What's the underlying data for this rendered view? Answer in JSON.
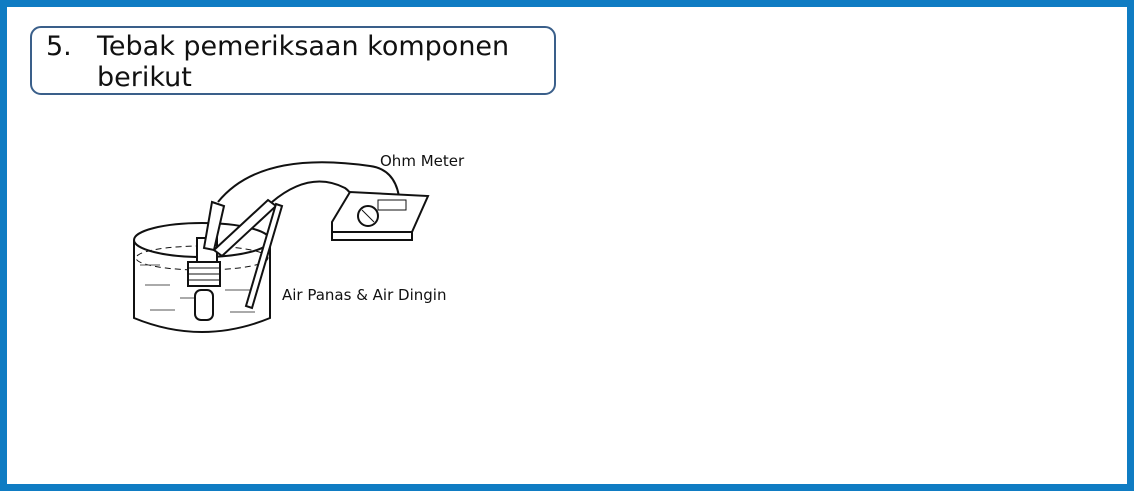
{
  "question": {
    "number": "5.",
    "text": "Tebak pemeriksaan komponen berikut"
  },
  "diagram": {
    "label_meter": "Ohm Meter",
    "label_water": "Air Panas & Air Dingin"
  },
  "colors": {
    "frame_border": "#0f7cc3",
    "title_border": "#3a5f8a"
  }
}
